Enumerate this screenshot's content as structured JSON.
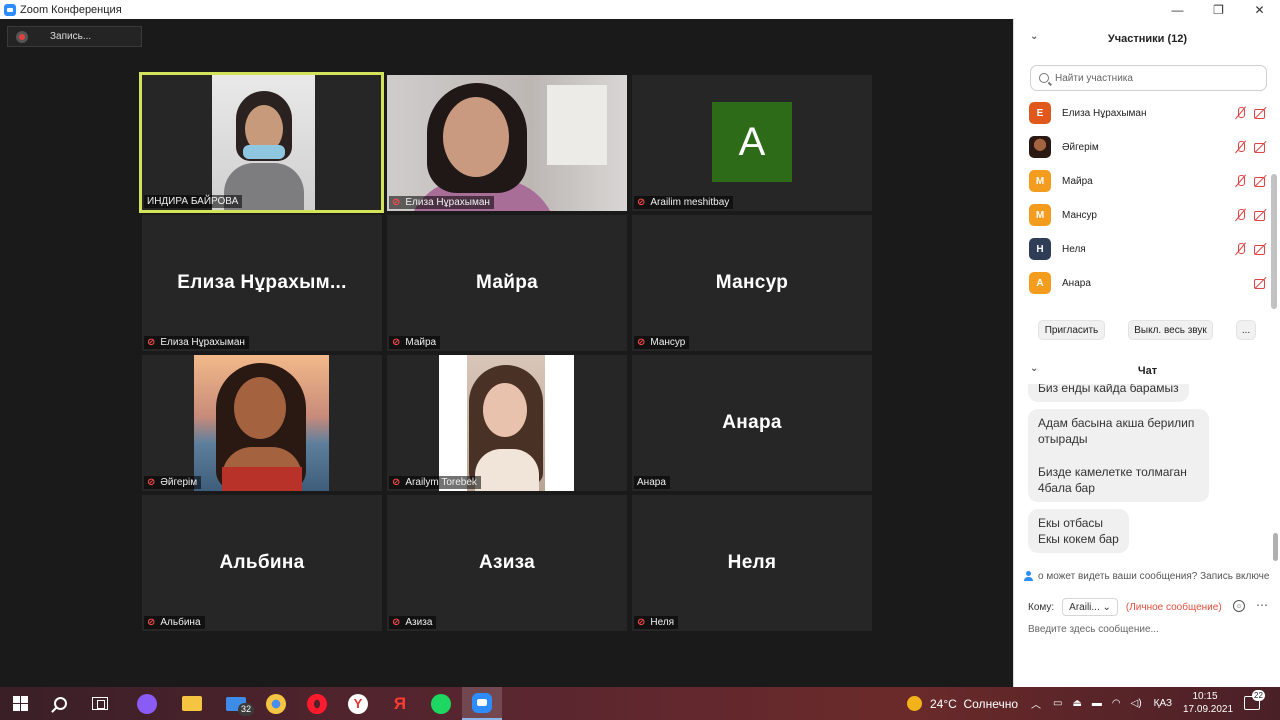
{
  "window": {
    "title": "Zoom Конференция",
    "min": "—",
    "max": "❐",
    "close": "✕"
  },
  "meeting": {
    "record_label": "Запись..."
  },
  "tiles": [
    {
      "label": "ИНДИРА БАЙРОВА",
      "muted": false,
      "active": true,
      "video": "indira"
    },
    {
      "label": "Елиза Нұрахыман",
      "muted": true,
      "video": "eliza"
    },
    {
      "label": "Arailim meshitbay",
      "muted": true,
      "avatar_letter": "A",
      "avatar_color": "#2e6b18"
    },
    {
      "label": "Елиза Нұрахыман",
      "display_name": "Елиза Нұрахым...",
      "muted": true
    },
    {
      "label": "Майра",
      "display_name": "Майра",
      "muted": true
    },
    {
      "label": "Мансур",
      "display_name": "Мансур",
      "muted": true
    },
    {
      "label": "Әйгерім",
      "muted": true,
      "video": "aigerim"
    },
    {
      "label": "Arailym Torebek",
      "muted": true,
      "video": "torebek"
    },
    {
      "label": "Анара",
      "display_name": "Анара",
      "muted": false
    },
    {
      "label": "Альбина",
      "display_name": "Альбина",
      "muted": true
    },
    {
      "label": "Азиза",
      "display_name": "Азиза",
      "muted": true
    },
    {
      "label": "Неля",
      "display_name": "Неля",
      "muted": true
    }
  ],
  "participants_panel": {
    "title": "Участники (12)",
    "search_placeholder": "Найти участника",
    "items": [
      {
        "initial": "Е",
        "name": "Елиза Нұрахыман",
        "color": "#e0581c"
      },
      {
        "initial": "",
        "name": "Әйгерім",
        "color": "#7a4a33"
      },
      {
        "initial": "М",
        "name": "Майра",
        "color": "#f39c1d"
      },
      {
        "initial": "М",
        "name": "Мансур",
        "color": "#f39c1d"
      },
      {
        "initial": "Н",
        "name": "Неля",
        "color": "#2f3e56"
      },
      {
        "initial": "А",
        "name": "Анара",
        "color": "#f39c1d"
      }
    ],
    "invite_label": "Пригласить",
    "mute_all_label": "Выкл. весь звук",
    "more_label": "..."
  },
  "chat": {
    "title": "Чат",
    "messages": [
      {
        "lines": [
          "Биз енды кайда барамыз"
        ]
      },
      {
        "lines": [
          "Адам басына акша берилип",
          "отырады",
          "",
          "Бизде камелетке толмаган",
          "4бала бар"
        ]
      },
      {
        "lines": [
          "Екы отбасы",
          "Екы кокем бар"
        ]
      }
    ],
    "notice": "о может видеть ваши сообщения? Запись включе",
    "to_label": "Кому:",
    "to_value": "Araili...",
    "private_label": "(Личное сообщение)",
    "input_placeholder": "Введите здесь сообщение..."
  },
  "taskbar": {
    "mail_badge": "32",
    "weather": "24°C",
    "weather_desc": "Солнечно",
    "lang": "ҚАЗ",
    "time": "10:15",
    "date": "17.09.2021",
    "notifications": "22"
  }
}
